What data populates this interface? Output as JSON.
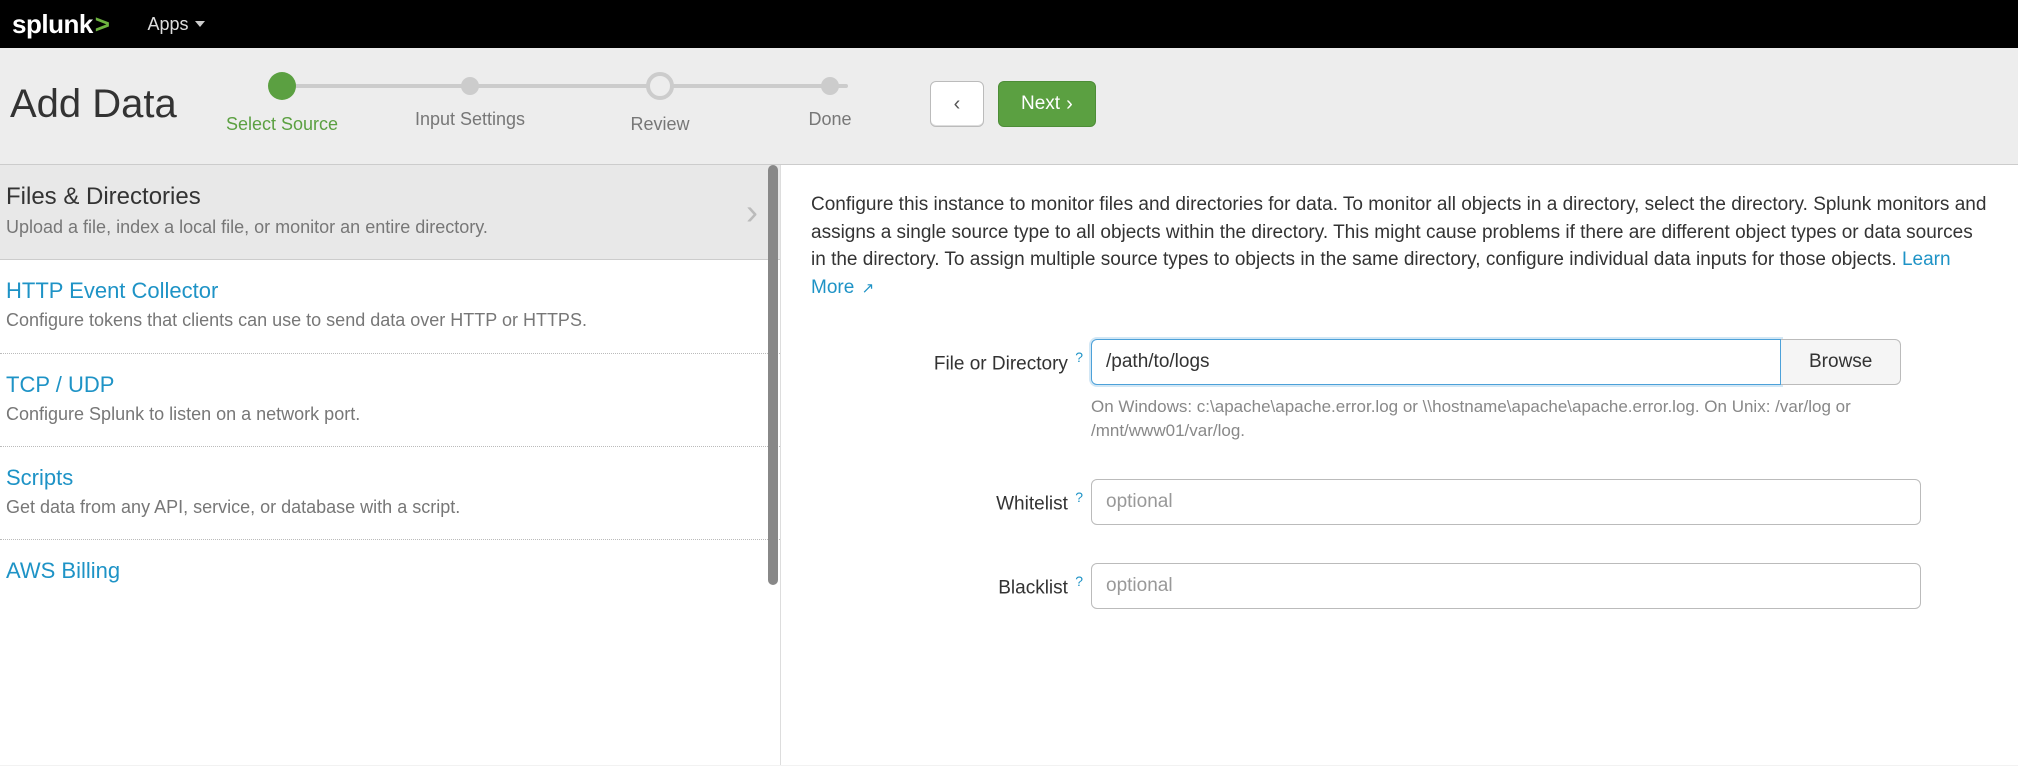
{
  "topbar": {
    "logo_text": "splunk",
    "apps_label": "Apps"
  },
  "header": {
    "title": "Add Data",
    "stepper": {
      "steps": [
        {
          "label": "Select Source",
          "state": "active"
        },
        {
          "label": "Input Settings",
          "state": "normal"
        },
        {
          "label": "Review",
          "state": "ring"
        },
        {
          "label": "Done",
          "state": "normal"
        }
      ]
    },
    "next_label": "Next"
  },
  "sidebar": {
    "items": [
      {
        "title": "Files & Directories",
        "desc": "Upload a file, index a local file, or monitor an entire directory.",
        "selected": true
      },
      {
        "title": "HTTP Event Collector",
        "desc": "Configure tokens that clients can use to send data over HTTP or HTTPS.",
        "selected": false
      },
      {
        "title": "TCP / UDP",
        "desc": "Configure Splunk to listen on a network port.",
        "selected": false
      },
      {
        "title": "Scripts",
        "desc": "Get data from any API, service, or database with a script.",
        "selected": false
      },
      {
        "title": "AWS Billing",
        "desc": "",
        "selected": false
      }
    ]
  },
  "content": {
    "description": "Configure this instance to monitor files and directories for data. To monitor all objects in a directory, select the directory. Splunk monitors and assigns a single source type to all objects within the directory. This might cause problems if there are different object types or data sources in the directory. To assign multiple source types to objects in the same directory, configure individual data inputs for those objects. ",
    "learn_more": "Learn More",
    "file_dir_label": "File or Directory",
    "file_dir_value": "/path/to/logs",
    "browse_label": "Browse",
    "file_dir_hint": "On Windows: c:\\apache\\apache.error.log or \\\\hostname\\apache\\apache.error.log. On Unix: /var/log or /mnt/www01/var/log.",
    "whitelist_label": "Whitelist",
    "whitelist_placeholder": "optional",
    "blacklist_label": "Blacklist",
    "blacklist_placeholder": "optional"
  }
}
